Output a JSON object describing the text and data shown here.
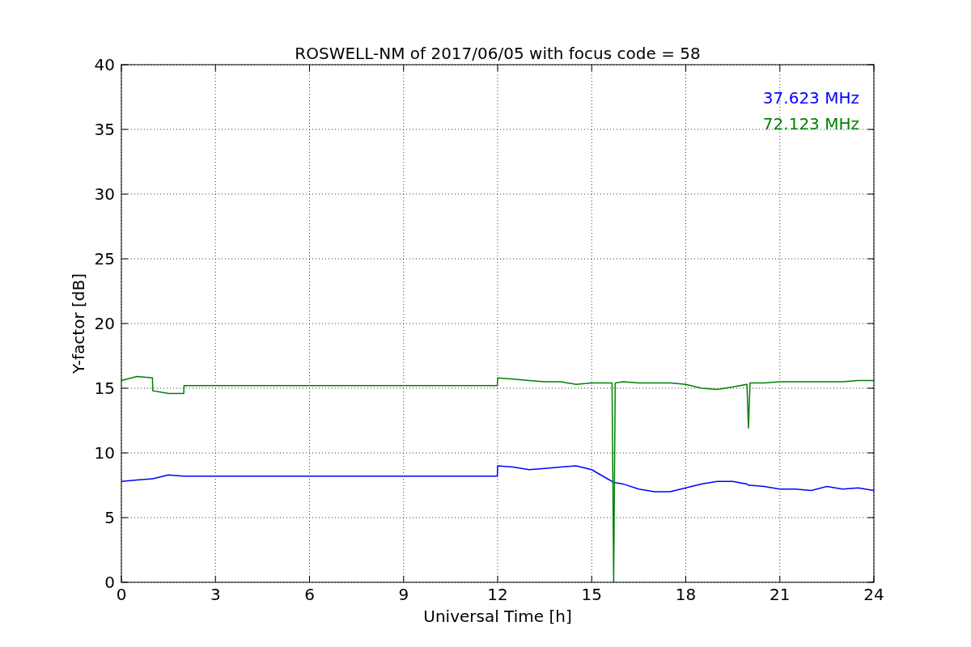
{
  "figure": {
    "chart_data": {
      "type": "line",
      "title": "ROSWELL-NM of 2017/06/05 with focus code = 58",
      "xlabel": "Universal Time [h]",
      "ylabel": "Y-factor [dB]",
      "x": [
        0,
        0.5,
        0.99,
        1.0,
        1.5,
        1.99,
        2.0,
        3,
        6,
        9,
        11.99,
        12.0,
        12.5,
        13,
        13.5,
        14,
        14.5,
        15,
        15.5,
        15.65,
        15.7,
        15.75,
        16,
        16.5,
        17,
        17.5,
        18,
        18.5,
        19,
        19.5,
        19.95,
        20.0,
        20.05,
        20.5,
        21,
        21.5,
        22,
        22.5,
        23,
        23.5,
        24
      ],
      "series": [
        {
          "name": "37.623 MHz",
          "color": "#0000ff",
          "values": [
            7.8,
            7.9,
            8.0,
            8.0,
            8.3,
            8.2,
            8.2,
            8.2,
            8.2,
            8.2,
            8.2,
            9.0,
            8.9,
            8.7,
            8.8,
            8.9,
            9.0,
            8.7,
            8.0,
            7.8,
            7.7,
            7.7,
            7.6,
            7.2,
            7.0,
            7.0,
            7.3,
            7.6,
            7.8,
            7.8,
            7.6,
            7.5,
            7.5,
            7.4,
            7.2,
            7.2,
            7.1,
            7.4,
            7.2,
            7.3,
            7.1
          ]
        },
        {
          "name": "72.123 MHz",
          "color": "#008000",
          "values": [
            15.6,
            15.9,
            15.8,
            14.8,
            14.6,
            14.6,
            15.2,
            15.2,
            15.2,
            15.2,
            15.2,
            15.8,
            15.7,
            15.6,
            15.5,
            15.5,
            15.3,
            15.4,
            15.4,
            15.4,
            0,
            15.4,
            15.5,
            15.4,
            15.4,
            15.4,
            15.3,
            15.0,
            14.9,
            15.1,
            15.3,
            11.9,
            15.4,
            15.4,
            15.5,
            15.5,
            15.5,
            15.5,
            15.5,
            15.6,
            15.6
          ]
        }
      ],
      "xlim": [
        0,
        24
      ],
      "ylim": [
        0,
        40
      ],
      "grid": true,
      "xticks": [
        0,
        3,
        6,
        9,
        12,
        15,
        18,
        21,
        24
      ],
      "yticks": [
        0,
        5,
        10,
        15,
        20,
        25,
        30,
        35,
        40
      ]
    }
  }
}
